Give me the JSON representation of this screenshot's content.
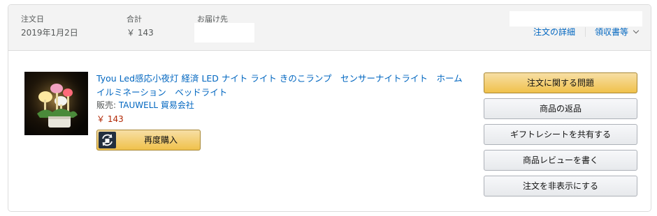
{
  "header": {
    "order_date_label": "注文日",
    "order_date_value": "2019年1月2日",
    "total_label": "合計",
    "total_value": "￥ 143",
    "ship_to_label": "お届け先",
    "order_details_link": "注文の詳細",
    "receipt_link": "領収書等"
  },
  "item": {
    "title": "Tyou Led感応小夜灯 経済 LED ナイト ライト きのこランプ　センサーナイトライト　ホームイルミネーション　ベッドライト",
    "seller_prefix": "販売: ",
    "seller_name": "TAUWELL 貿易会社",
    "price": "￥ 143",
    "buy_again_label": "再度購入"
  },
  "actions": {
    "problem_button": "注文に関する問題",
    "return_button": "商品の返品",
    "gift_receipt_button": "ギフトレシートを共有する",
    "review_button": "商品レビューを書く",
    "hide_order_button": "注文を非表示にする"
  },
  "colors": {
    "link": "#0066c0",
    "price": "#b12704",
    "primary_button": "#f0c14b",
    "header_bg": "#f3f3f3"
  }
}
